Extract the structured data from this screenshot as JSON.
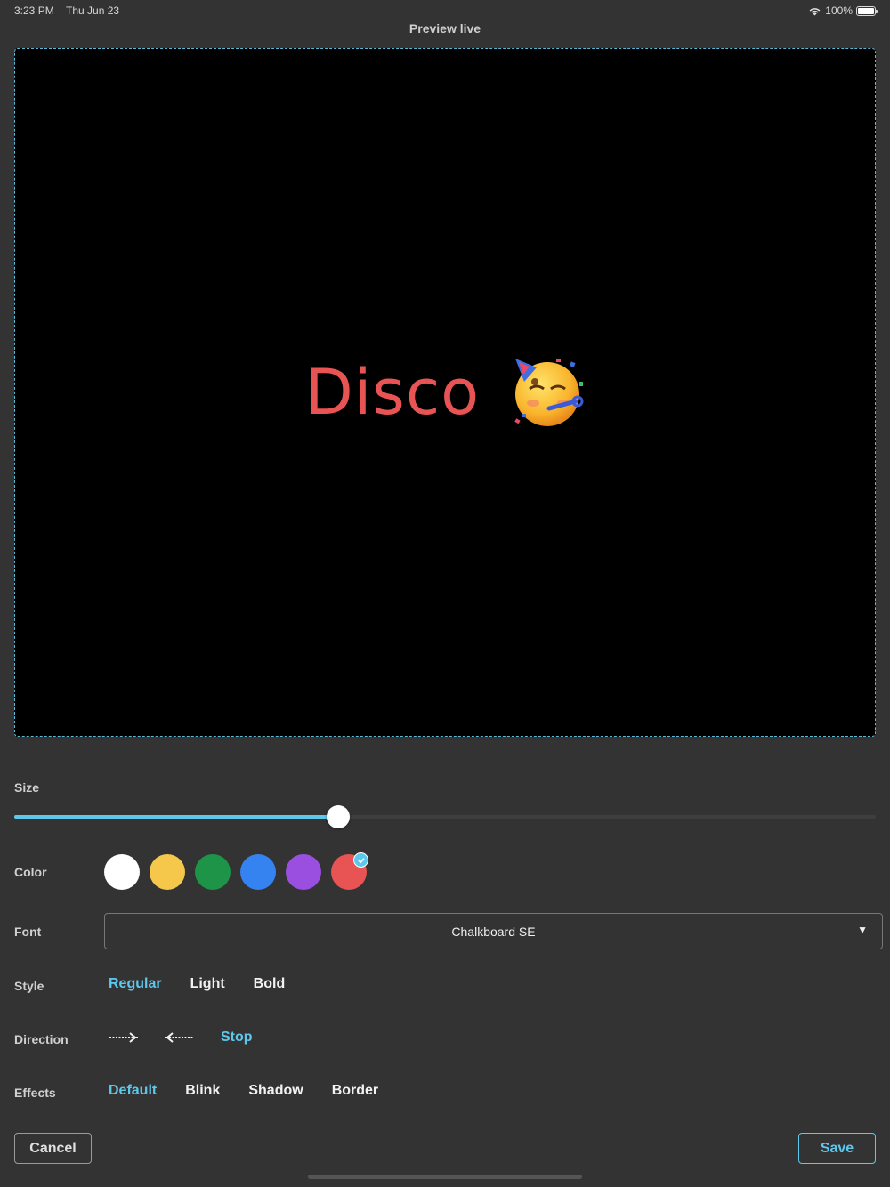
{
  "status_bar": {
    "time": "3:23 PM",
    "date": "Thu Jun 23",
    "battery": "100%"
  },
  "header": {
    "title": "Preview live"
  },
  "preview": {
    "text": "Disco",
    "emoji": "partying-face-emoji",
    "text_color": "#e85454"
  },
  "size": {
    "label": "Size",
    "value_fraction": 0.376
  },
  "color": {
    "label": "Color",
    "swatches": [
      "#ffffff",
      "#f5c84c",
      "#1e9448",
      "#3483f0",
      "#9b4fe0",
      "#e85454"
    ],
    "selected_index": 5
  },
  "font": {
    "label": "Font",
    "value": "Chalkboard SE"
  },
  "style": {
    "label": "Style",
    "options": [
      "Regular",
      "Light",
      "Bold"
    ],
    "selected": "Regular"
  },
  "direction": {
    "label": "Direction",
    "options": [
      "arrow-right-icon",
      "arrow-left-icon",
      "Stop"
    ],
    "stop_label": "Stop",
    "selected": "Stop"
  },
  "effects": {
    "label": "Effects",
    "options": [
      "Default",
      "Blink",
      "Shadow",
      "Border"
    ],
    "selected": "Default"
  },
  "buttons": {
    "cancel": "Cancel",
    "save": "Save"
  }
}
